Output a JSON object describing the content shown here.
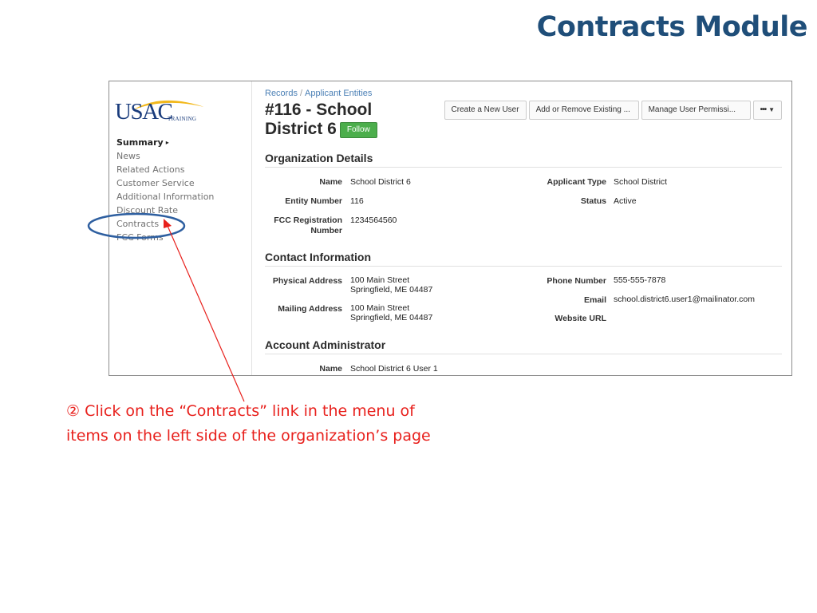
{
  "slide_title": "Contracts Module",
  "logo": {
    "text": "USAC",
    "subtext": "TRAINING"
  },
  "sidebar": {
    "items": [
      {
        "label": "Summary",
        "active": true
      },
      {
        "label": "News"
      },
      {
        "label": "Related Actions"
      },
      {
        "label": "Customer Service"
      },
      {
        "label": "Additional Information"
      },
      {
        "label": "Discount Rate"
      },
      {
        "label": "Contracts"
      },
      {
        "label": "FCC Forms"
      }
    ]
  },
  "breadcrumb": {
    "items": [
      "Records",
      "Applicant Entities"
    ],
    "separator": "/"
  },
  "page_title": {
    "line1": "#116 - School",
    "line2": "District 6"
  },
  "follow_button": "Follow",
  "toolbar": {
    "create_user": "Create a New User",
    "add_remove": "Add or Remove Existing ...",
    "manage_permissions": "Manage User Permissi...",
    "more": "•••"
  },
  "org_details": {
    "heading": "Organization Details",
    "name_label": "Name",
    "name_value": "School District 6",
    "entity_label": "Entity Number",
    "entity_value": "116",
    "fcc_label": "FCC Registration Number",
    "fcc_value": "1234564560",
    "type_label": "Applicant Type",
    "type_value": "School District",
    "status_label": "Status",
    "status_value": "Active"
  },
  "contact_info": {
    "heading": "Contact Information",
    "physical_label": "Physical Address",
    "physical_line1": "100 Main Street",
    "physical_line2": "Springfield, ME 04487",
    "mailing_label": "Mailing Address",
    "mailing_line1": "100 Main Street",
    "mailing_line2": "Springfield, ME 04487",
    "phone_label": "Phone Number",
    "phone_value": "555-555-7878",
    "email_label": "Email",
    "email_value": "school.district6.user1@mailinator.com",
    "website_label": "Website URL"
  },
  "account_admin": {
    "heading": "Account Administrator",
    "name_label": "Name",
    "name_value": "School District 6 User 1"
  },
  "instruction": {
    "line1": "② Click on the “Contracts” link in the menu of",
    "line2": "items on the left side of the organization’s page"
  },
  "colors": {
    "title": "#1f4e79",
    "annotation": "#e8201c",
    "highlight_ellipse": "#2e5fa0",
    "follow": "#4cae4c",
    "link": "#4a7fb5"
  },
  "icons": {
    "sidebar_caret": "caret-right-icon",
    "more_caret": "caret-down-icon"
  }
}
